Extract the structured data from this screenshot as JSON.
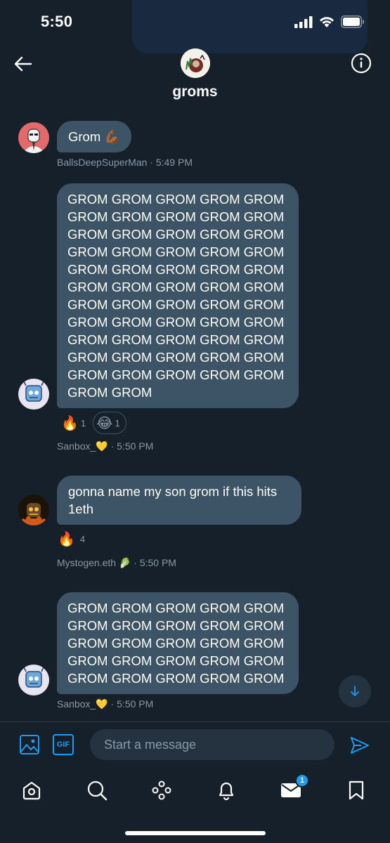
{
  "status": {
    "time": "5:50"
  },
  "header": {
    "title": "groms"
  },
  "messages": [
    {
      "text": "Grom 💪🏾",
      "sender": "BallsDeepSuperMan",
      "time": "· 5:49 PM"
    },
    {
      "text": "GROM GROM GROM GROM GROM GROM GROM GROM GROM GROM GROM GROM GROM GROM GROM GROM GROM GROM GROM GROM GROM GROM GROM GROM GROM GROM GROM GROM GROM GROM GROM GROM GROM GROM GROM GROM GROM GROM GROM GROM GROM GROM GROM GROM GROM GROM GROM GROM GROM GROM GROM GROM GROM GROM GROM GROM GROM",
      "sender": "Sanbox_💛",
      "time": "· 5:50 PM",
      "reactions": [
        {
          "emoji": "🔥",
          "count": "1"
        },
        {
          "emoji": "😂",
          "count": "1"
        }
      ]
    },
    {
      "text": "gonna name my son grom if this hits 1eth",
      "sender": "Mystogen.eth 🥬",
      "time": "· 5:50 PM",
      "reactions": [
        {
          "emoji": "🔥",
          "count": "4"
        }
      ]
    },
    {
      "text": "GROM GROM GROM GROM GROM GROM GROM GROM GROM GROM GROM GROM GROM GROM GROM GROM GROM GROM GROM GROM GROM GROM GROM GROM GROM",
      "sender": "Sanbox_💛",
      "time": "· 5:50 PM"
    }
  ],
  "composer": {
    "placeholder": "Start a message",
    "gif_label": "GIF"
  },
  "tabbar": {
    "messages_badge": "1"
  },
  "colors": {
    "background": "#15202b",
    "bubble": "#3d5466",
    "accent": "#1d9bf0",
    "meta": "#8899a6"
  }
}
